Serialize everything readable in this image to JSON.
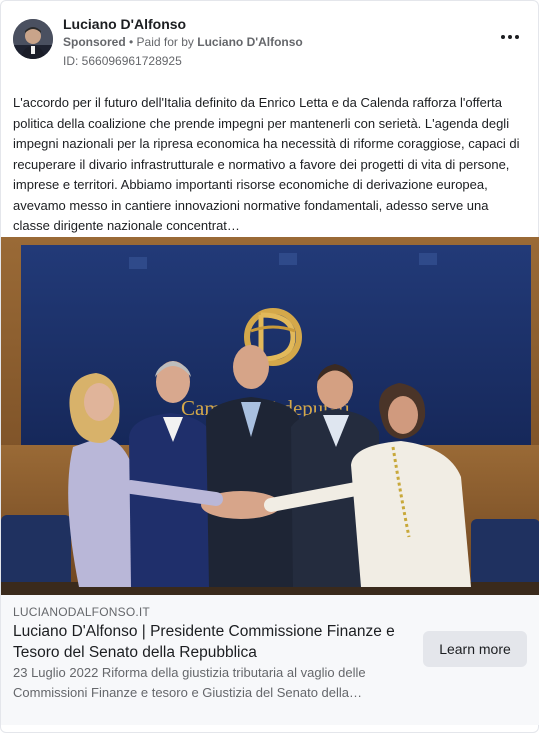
{
  "advertiser": {
    "name": "Luciano D'Alfonso",
    "sponsored_label": "Sponsored",
    "separator": " • ",
    "paid_for_prefix": "Paid for by ",
    "paid_for_name": "Luciano D'Alfonso",
    "ad_id": "ID: 566096961728925"
  },
  "post": {
    "text": "L'accordo per il futuro dell'Italia definito da Enrico Letta e da Calenda rafforza l'offerta politica della coalizione che prende impegni per mantenerli con serietà. L'agenda degli impegni nazionali per la ripresa economica ha necessità di riforme coraggiose, capaci di recuperare il divario infrastrutturale e normativo a favore dei progetti di vita di persone, imprese e territori. Abbiamo importanti risorse economiche di derivazione europea, avevamo messo in cantiere innovazioni normative fondamentali, adesso serve una classe dirigente nazionale concentrat…"
  },
  "photo": {
    "wall_lettering": "Camera dei deputati"
  },
  "link": {
    "domain": "LUCIANODALFONSO.IT",
    "title": "Luciano D'Alfonso | Presidente Commissione Finanze e Tesoro del Senato della Repubblica",
    "description": "23 Luglio 2022 Riforma della giustizia tributaria al vaglio delle Commissioni Finanze e tesoro e Giustizia del Senato della…",
    "cta_label": "Learn more"
  },
  "icons": {
    "more": "more-horizontal-icon"
  },
  "colors": {
    "text_primary": "#1c1e21",
    "text_secondary": "#65676b",
    "link_bg": "#f7f8fa",
    "button_bg": "#e4e6eb",
    "photo_wall_blue": "#1c2f66",
    "photo_wood": "#8a5a2b"
  }
}
